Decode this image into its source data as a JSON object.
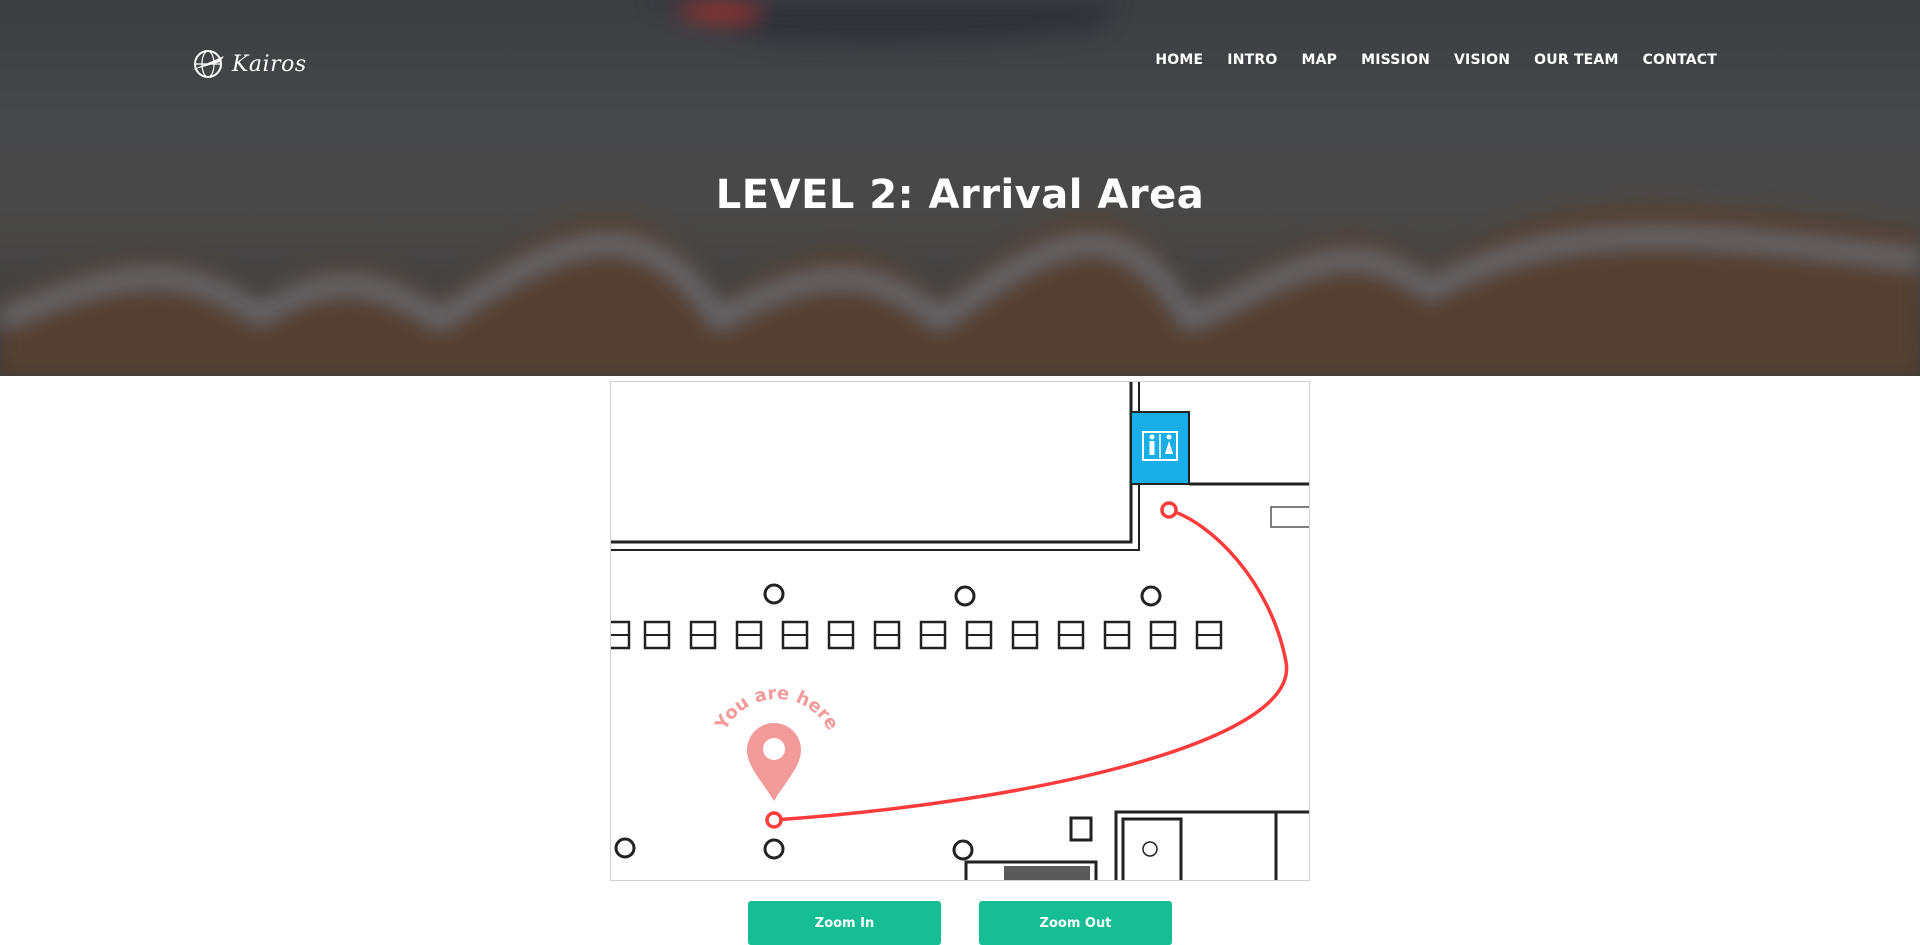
{
  "brand": {
    "name": "Kairos",
    "logo_icon": "globe-airplane-icon"
  },
  "nav": {
    "items": [
      {
        "label": "HOME"
      },
      {
        "label": "INTRO"
      },
      {
        "label": "MAP"
      },
      {
        "label": "MISSION"
      },
      {
        "label": "VISION"
      },
      {
        "label": "OUR TEAM"
      },
      {
        "label": "CONTACT"
      }
    ]
  },
  "header": {
    "title": "LEVEL 2: Arrival Area"
  },
  "map": {
    "you_are_here": "You are here",
    "marker_icon": "location-pin-icon",
    "restroom_icon": "restroom-icon",
    "route_color": "#ff3b3b",
    "restroom_color": "#1aaee8"
  },
  "controls": {
    "zoom_in": "Zoom In",
    "zoom_out": "Zoom Out"
  },
  "colors": {
    "accent": "#17bd93"
  }
}
